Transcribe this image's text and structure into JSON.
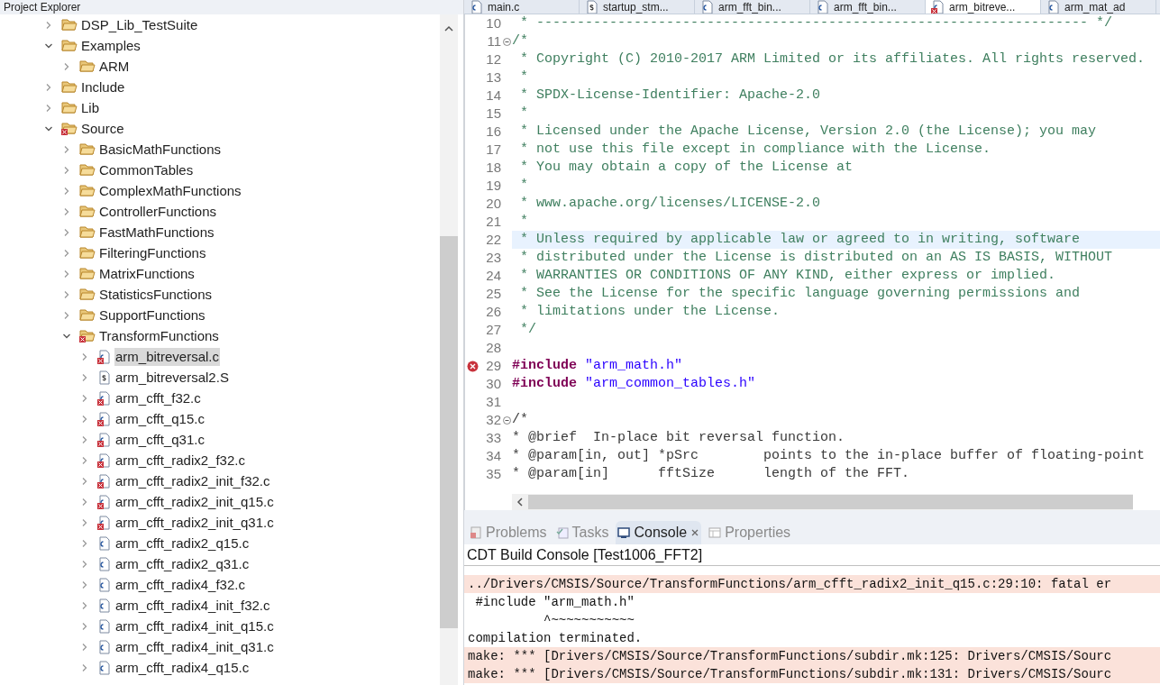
{
  "explorer": {
    "title": "Project Explorer",
    "tree": [
      {
        "label": "DSP_Lib_TestSuite",
        "kind": "folder",
        "expanded": false,
        "selected": false
      },
      {
        "label": "Examples",
        "kind": "folder",
        "expanded": true,
        "selected": false,
        "children": [
          {
            "label": "ARM",
            "kind": "folder",
            "expanded": false,
            "selected": false
          }
        ]
      },
      {
        "label": "Include",
        "kind": "folder",
        "expanded": false,
        "selected": false
      },
      {
        "label": "Lib",
        "kind": "folder",
        "expanded": false,
        "selected": false
      },
      {
        "label": "Source",
        "kind": "folder_error",
        "expanded": true,
        "selected": false,
        "children": [
          {
            "label": "BasicMathFunctions",
            "kind": "folder",
            "expanded": false,
            "selected": false
          },
          {
            "label": "CommonTables",
            "kind": "folder",
            "expanded": false,
            "selected": false
          },
          {
            "label": "ComplexMathFunctions",
            "kind": "folder",
            "expanded": false,
            "selected": false
          },
          {
            "label": "ControllerFunctions",
            "kind": "folder",
            "expanded": false,
            "selected": false
          },
          {
            "label": "FastMathFunctions",
            "kind": "folder",
            "expanded": false,
            "selected": false
          },
          {
            "label": "FilteringFunctions",
            "kind": "folder",
            "expanded": false,
            "selected": false
          },
          {
            "label": "MatrixFunctions",
            "kind": "folder",
            "expanded": false,
            "selected": false
          },
          {
            "label": "StatisticsFunctions",
            "kind": "folder",
            "expanded": false,
            "selected": false
          },
          {
            "label": "SupportFunctions",
            "kind": "folder",
            "expanded": false,
            "selected": false
          },
          {
            "label": "TransformFunctions",
            "kind": "folder_error",
            "expanded": true,
            "selected": false,
            "children": [
              {
                "label": "arm_bitreversal.c",
                "kind": "c_error",
                "expanded": false,
                "selected": true
              },
              {
                "label": "arm_bitreversal2.S",
                "kind": "s",
                "expanded": false,
                "selected": false
              },
              {
                "label": "arm_cfft_f32.c",
                "kind": "c_error",
                "expanded": false,
                "selected": false
              },
              {
                "label": "arm_cfft_q15.c",
                "kind": "c_error",
                "expanded": false,
                "selected": false
              },
              {
                "label": "arm_cfft_q31.c",
                "kind": "c_error",
                "expanded": false,
                "selected": false
              },
              {
                "label": "arm_cfft_radix2_f32.c",
                "kind": "c_error",
                "expanded": false,
                "selected": false
              },
              {
                "label": "arm_cfft_radix2_init_f32.c",
                "kind": "c_error",
                "expanded": false,
                "selected": false
              },
              {
                "label": "arm_cfft_radix2_init_q15.c",
                "kind": "c_error",
                "expanded": false,
                "selected": false
              },
              {
                "label": "arm_cfft_radix2_init_q31.c",
                "kind": "c_error",
                "expanded": false,
                "selected": false
              },
              {
                "label": "arm_cfft_radix2_q15.c",
                "kind": "c",
                "expanded": false,
                "selected": false
              },
              {
                "label": "arm_cfft_radix2_q31.c",
                "kind": "c",
                "expanded": false,
                "selected": false
              },
              {
                "label": "arm_cfft_radix4_f32.c",
                "kind": "c",
                "expanded": false,
                "selected": false
              },
              {
                "label": "arm_cfft_radix4_init_f32.c",
                "kind": "c",
                "expanded": false,
                "selected": false
              },
              {
                "label": "arm_cfft_radix4_init_q15.c",
                "kind": "c",
                "expanded": false,
                "selected": false
              },
              {
                "label": "arm_cfft_radix4_init_q31.c",
                "kind": "c",
                "expanded": false,
                "selected": false
              },
              {
                "label": "arm_cfft_radix4_q15.c",
                "kind": "c",
                "expanded": false,
                "selected": false
              }
            ]
          }
        ]
      }
    ]
  },
  "editor": {
    "tabs": [
      {
        "label": "main.c",
        "selected": false,
        "kind": "c"
      },
      {
        "label": "startup_stm...",
        "selected": false,
        "kind": "s"
      },
      {
        "label": "arm_fft_bin...",
        "selected": false,
        "kind": "c"
      },
      {
        "label": "arm_fft_bin...",
        "selected": false,
        "kind": "c"
      },
      {
        "label": "arm_bitreve...",
        "selected": true,
        "kind": "c_error"
      },
      {
        "label": "arm_mat_ad",
        "selected": false,
        "kind": "c"
      }
    ],
    "lines": [
      {
        "number": "10",
        "kind": "comment",
        "text": " * -------------------------------------------------------------------- */"
      },
      {
        "number": "11",
        "kind": "comment",
        "text": "/*",
        "fold": true
      },
      {
        "number": "12",
        "kind": "comment",
        "text": " * Copyright (C) 2010-2017 ARM Limited or its affiliates. All rights reserved."
      },
      {
        "number": "13",
        "kind": "comment",
        "text": " *"
      },
      {
        "number": "14",
        "kind": "comment",
        "text": " * SPDX-License-Identifier: Apache-2.0"
      },
      {
        "number": "15",
        "kind": "comment",
        "text": " *"
      },
      {
        "number": "16",
        "kind": "comment",
        "text": " * Licensed under the Apache License, Version 2.0 (the License); you may"
      },
      {
        "number": "17",
        "kind": "comment",
        "text": " * not use this file except in compliance with the License."
      },
      {
        "number": "18",
        "kind": "comment",
        "text": " * You may obtain a copy of the License at"
      },
      {
        "number": "19",
        "kind": "comment",
        "text": " *"
      },
      {
        "number": "20",
        "kind": "comment",
        "text": " * www.apache.org/licenses/LICENSE-2.0"
      },
      {
        "number": "21",
        "kind": "comment",
        "text": " *"
      },
      {
        "number": "22",
        "kind": "comment",
        "text": " * Unless required by applicable law or agreed to in writing, software",
        "current": true
      },
      {
        "number": "23",
        "kind": "comment",
        "text": " * distributed under the License is distributed on an AS IS BASIS, WITHOUT"
      },
      {
        "number": "24",
        "kind": "comment",
        "text": " * WARRANTIES OR CONDITIONS OF ANY KIND, either express or implied."
      },
      {
        "number": "25",
        "kind": "comment",
        "text": " * See the License for the specific language governing permissions and"
      },
      {
        "number": "26",
        "kind": "comment",
        "text": " * limitations under the License."
      },
      {
        "number": "27",
        "kind": "comment",
        "text": " */"
      },
      {
        "number": "28",
        "kind": "plain"
      },
      {
        "number": "29",
        "kind": "include",
        "directive": "#include",
        "text": " \"arm_math.h\"",
        "error": true
      },
      {
        "number": "30",
        "kind": "include",
        "directive": "#include",
        "text": " \"arm_common_tables.h\""
      },
      {
        "number": "31",
        "kind": "plain"
      },
      {
        "number": "32",
        "kind": "plain",
        "text": "/*",
        "fold": true
      },
      {
        "number": "33",
        "kind": "plain",
        "text": "* @brief  In-place bit reversal function."
      },
      {
        "number": "34",
        "kind": "plain",
        "text": "* @param[in, out] *pSrc        points to the in-place buffer of floating-point"
      },
      {
        "number": "35",
        "kind": "plain",
        "text": "* @param[in]      fftSize      length of the FFT."
      }
    ]
  },
  "panel": {
    "tabs": [
      {
        "label": "Problems",
        "selected": false,
        "kind": "problems"
      },
      {
        "label": "Tasks",
        "selected": false,
        "kind": "tasks"
      },
      {
        "label": "Console",
        "selected": true,
        "kind": "console"
      },
      {
        "label": "Properties",
        "selected": false,
        "kind": "properties"
      }
    ],
    "console_title": "CDT Build Console [Test1006_FFT2]",
    "lines": [
      {
        "text": "../Drivers/CMSIS/Source/TransformFunctions/arm_cfft_radix2_init_q15.c:29:10: fatal er",
        "error": true
      },
      {
        "text": " #include \"arm_math.h\"",
        "error": false
      },
      {
        "text": "          ^~~~~~~~~~~~",
        "error": false
      },
      {
        "text": "compilation terminated.",
        "error": false
      },
      {
        "text": "make: *** [Drivers/CMSIS/Source/TransformFunctions/subdir.mk:125: Drivers/CMSIS/Sourc",
        "error": true
      },
      {
        "text": "make: *** [Drivers/CMSIS/Source/TransformFunctions/subdir.mk:131: Drivers/CMSIS/Sourc",
        "error": true
      }
    ]
  }
}
